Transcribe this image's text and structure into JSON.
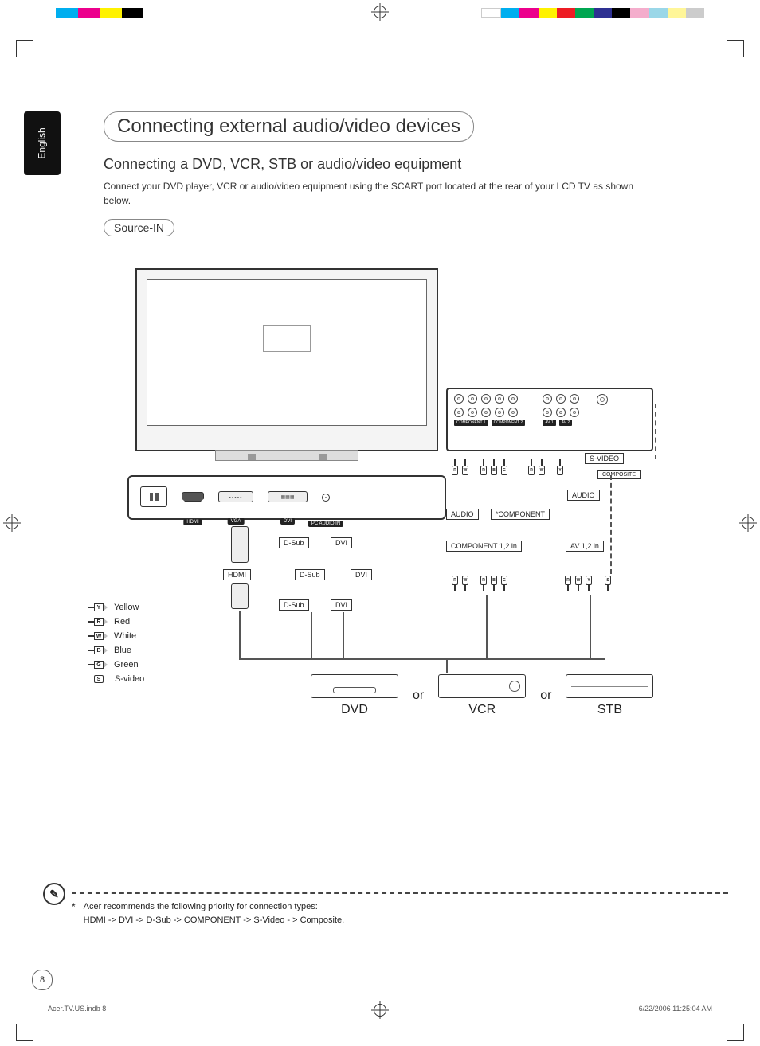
{
  "language_tab": "English",
  "title": "Connecting external audio/video devices",
  "subtitle": "Connecting a DVD, VCR, STB or audio/video equipment",
  "body": "Connect your DVD player, VCR or audio/video equipment using the SCART port located at the rear of your LCD TV as shown below.",
  "section": "Source-IN",
  "port_strip": {
    "hdmi": "HDMI",
    "vga": "VGA",
    "dvi": "DVI",
    "pc_audio": "PC AUDIO IN"
  },
  "connectors": {
    "hdmi": "HDMI",
    "dsub": "D-Sub",
    "dvi": "DVI"
  },
  "side_panel": {
    "comp1": "COMPONENT 1",
    "comp2": "COMPONENT 2",
    "av1": "AV 1",
    "av2": "AV 2"
  },
  "labels": {
    "svideo": "S-VIDEO",
    "composite": "COMPOSITE",
    "audio": "AUDIO",
    "component_star": "*COMPONENT",
    "component12": "COMPONENT 1,2 in",
    "av12": "AV 1,2 in"
  },
  "rca_letters": {
    "r": "R",
    "w": "W",
    "b": "B",
    "g": "G",
    "y": "Y",
    "s": "S"
  },
  "legend": [
    {
      "code": "Y",
      "label": "Yellow"
    },
    {
      "code": "R",
      "label": "Red"
    },
    {
      "code": "W",
      "label": "White"
    },
    {
      "code": "B",
      "label": "Blue"
    },
    {
      "code": "G",
      "label": "Green"
    },
    {
      "code": "S",
      "label": "S-video"
    }
  ],
  "devices": {
    "dvd": "DVD",
    "vcr": "VCR",
    "stb": "STB",
    "or": "or"
  },
  "footnote": {
    "star": "*",
    "line1": "Acer recommends the following priority for connection types:",
    "line2": "HDMI -> DVI -> D-Sub -> COMPONENT -> S-Video - > Composite."
  },
  "page_number": "8",
  "slug_left": "Acer.TV.US.indb   8",
  "slug_right": "6/22/2006   11:25:04 AM",
  "colorbar": [
    "#00aeef",
    "#ec008c",
    "#fff200",
    "#000000"
  ],
  "colorbar_r": [
    "#fff",
    "#00aeef",
    "#ec008c",
    "#fff200",
    "#ed1c24",
    "#00a651",
    "#2e3192",
    "#000",
    "#ec008c",
    "#00aeef",
    "#fff200",
    "#fff"
  ]
}
